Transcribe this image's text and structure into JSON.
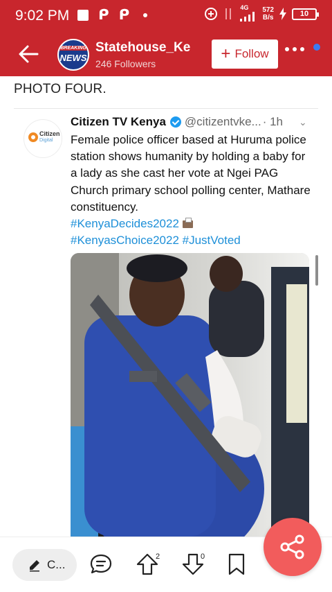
{
  "status_bar": {
    "time": "9:02 PM",
    "net_type": "4G",
    "net_speed_value": "572",
    "net_speed_unit": "B/s",
    "battery": "10"
  },
  "header": {
    "channel_name": "Statehouse_Ke",
    "followers": "246 Followers",
    "follow_label": "Follow",
    "follow_plus": "+",
    "avatar_top_text": "BREAKING",
    "avatar_main_text": "NEWS"
  },
  "post": {
    "heading": "PHOTO FOUR."
  },
  "tweet": {
    "author_name": "Citizen TV Kenya",
    "handle": "@citizentvke...",
    "time": "· 1h",
    "text": "Female police officer based at Huruma police station shows humanity by holding a baby for a lady as she cast her vote at Ngei PAG Church primary school polling center, Mathare constituency.",
    "hashtag_line_1": "#KenyaDecides2022",
    "hashtag_line_2": "#KenyasChoice2022 #JustVoted",
    "avatar_text_1": "Citizen",
    "avatar_text_2": "Digital"
  },
  "bottom_bar": {
    "comment_label": "C...",
    "upvote_count": "2",
    "downvote_count": "0"
  },
  "colors": {
    "brand_red": "#c8262d",
    "link_blue": "#1d8fd8",
    "fab_red": "#f25c5c",
    "verified_blue": "#1d9bf0"
  }
}
